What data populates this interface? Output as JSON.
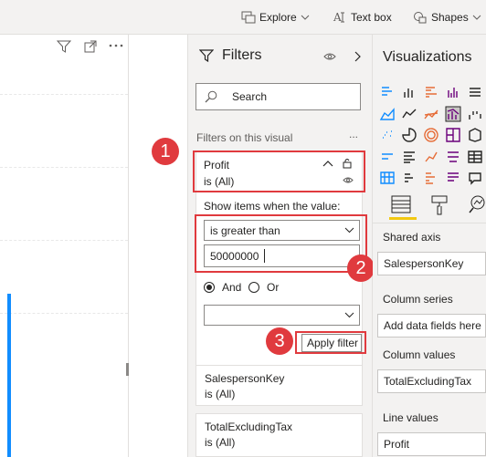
{
  "ribbon": {
    "explore": "Explore",
    "text_box": "Text box",
    "shapes": "Shapes"
  },
  "filters": {
    "title": "Filters",
    "search_placeholder": "Search",
    "section_label": "Filters on this visual",
    "more_label": "...",
    "active_filter": {
      "field": "Profit",
      "state": "is (All)",
      "show_items_label": "Show items when the value:",
      "condition": "is greater than",
      "value": "50000000",
      "and_label": "And",
      "or_label": "Or",
      "selected_logic": "And",
      "apply_label": "Apply filter"
    },
    "other_filters": [
      {
        "field": "SalespersonKey",
        "state": "is (All)"
      },
      {
        "field": "TotalExcludingTax",
        "state": "is (All)"
      }
    ]
  },
  "callouts": [
    "1",
    "2",
    "3"
  ],
  "visualizations": {
    "title": "Visualizations",
    "wells": {
      "shared_axis_label": "Shared axis",
      "shared_axis_value": "SalespersonKey",
      "column_series_label": "Column series",
      "column_series_placeholder": "Add data fields here",
      "column_values_label": "Column values",
      "column_values_value": "TotalExcludingTax",
      "line_values_label": "Line values",
      "line_values_value": "Profit"
    }
  },
  "colors": {
    "accent_red": "#e03a3e",
    "powerbi_yellow": "#f2c811",
    "chart_blue": "#118dff"
  }
}
